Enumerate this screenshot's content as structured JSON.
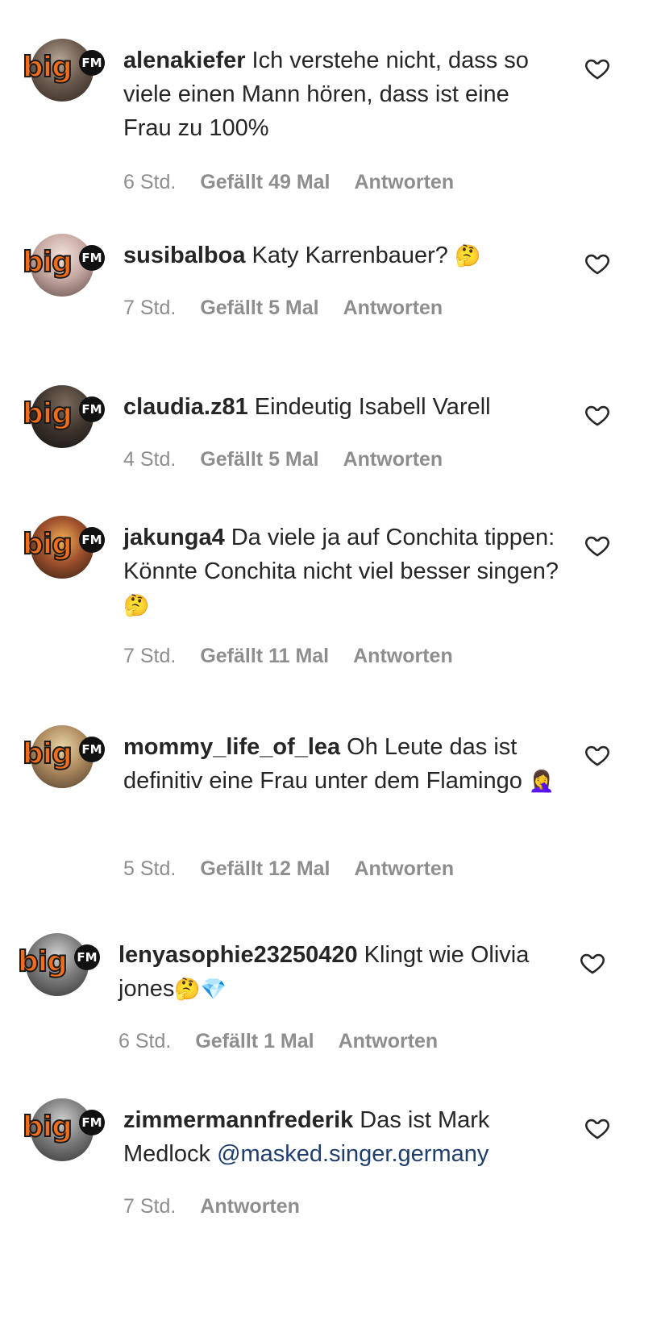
{
  "comments": [
    {
      "username": "alenakiefer",
      "text": "Ich verstehe nicht, dass so viele einen Mann hören, dass ist eine Frau zu 100%",
      "emoji": "",
      "time": "6 Std.",
      "likes": "Gefällt 49 Mal",
      "reply": "Antworten",
      "avatar_logo": "big",
      "avatar_badge": "FM"
    },
    {
      "username": "susibalboa",
      "text": "Katy Karrenbauer?",
      "emoji": "🤔",
      "time": "7 Std.",
      "likes": "Gefällt 5 Mal",
      "reply": "Antworten",
      "avatar_logo": "big",
      "avatar_badge": "FM"
    },
    {
      "username": "claudia.z81",
      "text": "Eindeutig Isabell Varell",
      "emoji": "",
      "time": "4 Std.",
      "likes": "Gefällt 5 Mal",
      "reply": "Antworten",
      "avatar_logo": "big",
      "avatar_badge": "FM"
    },
    {
      "username": "jakunga4",
      "text": "Da viele ja auf Conchita tippen: Könnte Conchita nicht viel besser singen?",
      "emoji": "🤔",
      "time": "7 Std.",
      "likes": "Gefällt 11 Mal",
      "reply": "Antworten",
      "avatar_logo": "big",
      "avatar_badge": "FM"
    },
    {
      "username": "mommy_life_of_lea",
      "text": "Oh Leute das ist definitiv eine Frau unter dem Flamingo",
      "emoji": "🤦‍♀️",
      "time": "5 Std.",
      "likes": "Gefällt 12 Mal",
      "reply": "Antworten",
      "avatar_logo": "big",
      "avatar_badge": "FM"
    },
    {
      "username": "lenyasophie23250420",
      "text": "Klingt wie Olivia jones",
      "emoji": "🤔💎",
      "time": "6 Std.",
      "likes": "Gefällt 1 Mal",
      "reply": "Antworten",
      "avatar_logo": "big",
      "avatar_badge": "FM"
    },
    {
      "username": "zimmermannfrederik",
      "text": "Das ist Mark Medlock",
      "mention": "@masked.singer.germany",
      "emoji": "",
      "time": "7 Std.",
      "reply": "Antworten",
      "avatar_logo": "big",
      "avatar_badge": "FM"
    }
  ],
  "icons": {
    "like": "heart-outline-icon"
  },
  "colors": {
    "text": "#262626",
    "meta": "#8e8e8e",
    "mention": "#1f3e6d",
    "logo": "#f26c1a"
  }
}
